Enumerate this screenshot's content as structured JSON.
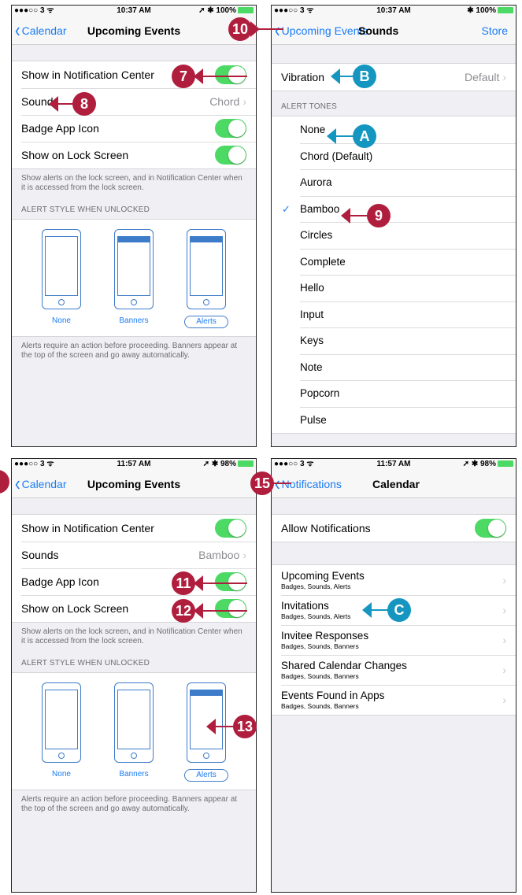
{
  "panel1": {
    "status": {
      "carrier": "●●●○○ 3 ᯤ",
      "time": "10:37 AM",
      "battery": "➚ ✱ 100%"
    },
    "nav": {
      "back": "Calendar",
      "title": "Upcoming Events"
    },
    "rows": [
      {
        "label": "Show in Notification Center",
        "toggle": true
      },
      {
        "label": "Sounds",
        "value": "Chord"
      },
      {
        "label": "Badge App Icon",
        "toggle": true
      },
      {
        "label": "Show on Lock Screen",
        "toggle": true
      }
    ],
    "lock_note": "Show alerts on the lock screen, and in Notification Center when it is accessed from the lock screen.",
    "style_header": "ALERT STYLE WHEN UNLOCKED",
    "styles": [
      "None",
      "Banners",
      "Alerts"
    ],
    "style_note": "Alerts require an action before proceeding. Banners appear at the top of the screen and go away automatically."
  },
  "panel2": {
    "status": {
      "carrier": "●●●○○ 3 ᯤ",
      "time": "10:37 AM",
      "battery": "✱ 100%"
    },
    "nav": {
      "back": "Upcoming Events",
      "title": "Sounds",
      "right": "Store"
    },
    "vibration": {
      "label": "Vibration",
      "value": "Default"
    },
    "tones_header": "ALERT TONES",
    "tones": [
      "None",
      "Chord (Default)",
      "Aurora",
      "Bamboo",
      "Circles",
      "Complete",
      "Hello",
      "Input",
      "Keys",
      "Note",
      "Popcorn",
      "Pulse"
    ],
    "selected_tone": "Bamboo"
  },
  "panel3": {
    "status": {
      "carrier": "●●●○○ 3 ᯤ",
      "time": "11:57 AM",
      "battery": "➚ ✱ 98%"
    },
    "nav": {
      "back": "Calendar",
      "title": "Upcoming Events"
    },
    "rows": [
      {
        "label": "Show in Notification Center",
        "toggle": true
      },
      {
        "label": "Sounds",
        "value": "Bamboo"
      },
      {
        "label": "Badge App Icon",
        "toggle": true
      },
      {
        "label": "Show on Lock Screen",
        "toggle": true
      }
    ],
    "lock_note": "Show alerts on the lock screen, and in Notification Center when it is accessed from the lock screen.",
    "style_header": "ALERT STYLE WHEN UNLOCKED",
    "styles": [
      "None",
      "Banners",
      "Alerts"
    ],
    "style_note": "Alerts require an action before proceeding. Banners appear at the top of the screen and go away automatically."
  },
  "panel4": {
    "status": {
      "carrier": "●●●○○ 3 ᯤ",
      "time": "11:57 AM",
      "battery": "➚ ✱ 98%"
    },
    "nav": {
      "back": "Notifications",
      "title": "Calendar"
    },
    "allow": "Allow Notifications",
    "items": [
      {
        "title": "Upcoming Events",
        "sub": "Badges, Sounds, Alerts"
      },
      {
        "title": "Invitations",
        "sub": "Badges, Sounds, Alerts"
      },
      {
        "title": "Invitee Responses",
        "sub": "Badges, Sounds, Banners"
      },
      {
        "title": "Shared Calendar Changes",
        "sub": "Badges, Sounds, Banners"
      },
      {
        "title": "Events Found in Apps",
        "sub": "Badges, Sounds, Banners"
      }
    ]
  },
  "callouts": {
    "c7": "7",
    "c8": "8",
    "c9": "9",
    "c10": "10",
    "c11": "11",
    "c12": "12",
    "c13": "13",
    "c15": "15",
    "cA": "A",
    "cB": "B",
    "cC": "C"
  },
  "colors": {
    "accent": "#1a7cf5",
    "toggle_on": "#4cd964",
    "callout_red": "#b01e3e",
    "callout_teal": "#1596c0",
    "phone_outline": "#3d7cc9"
  }
}
